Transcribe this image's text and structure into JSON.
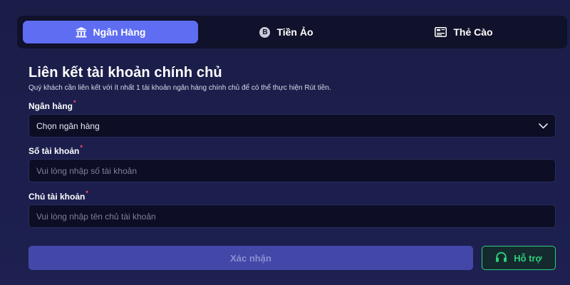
{
  "tabs": [
    {
      "label": "Ngân Hàng",
      "icon": "bank-icon",
      "active": true
    },
    {
      "label": "Tiền Ảo",
      "icon": "bitcoin-icon",
      "active": false
    },
    {
      "label": "Thẻ Cào",
      "icon": "card-icon",
      "active": false
    }
  ],
  "form": {
    "title": "Liên kết tài khoản chính chủ",
    "subtitle": "Quý khách cần liên kết với ít nhất 1 tài khoản ngân hàng chính chủ để có thể thực hiện Rút tiền.",
    "bank_label": "Ngân hàng",
    "bank_value": "Chọn ngân hàng",
    "account_number_label": "Số tài khoản",
    "account_number_placeholder": "Vui lòng nhập số tài khoản",
    "account_holder_label": "Chủ tài khoản",
    "account_holder_placeholder": "Vui lòng nhập tên chủ tài khoản",
    "required_mark": "*",
    "coin_glyph": "B"
  },
  "actions": {
    "confirm_label": "Xác nhận",
    "support_label": "Hỗ trợ"
  },
  "colors": {
    "accent": "#5e6df2",
    "support_green": "#2fd07a",
    "required_red": "#ff4d6d"
  }
}
